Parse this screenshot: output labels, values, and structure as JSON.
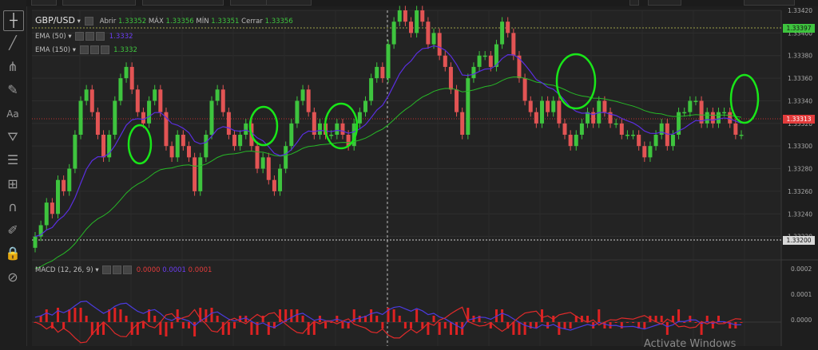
{
  "toolbar": {
    "tools": [
      {
        "name": "crosshair-tool",
        "glyph": "┼"
      },
      {
        "name": "trendline-tool",
        "glyph": "╱"
      },
      {
        "name": "fork-tool",
        "glyph": "⋔"
      },
      {
        "name": "brush-tool",
        "glyph": "✎"
      },
      {
        "name": "text-tool",
        "glyph": "Aa"
      },
      {
        "name": "pattern-tool",
        "glyph": "⛛"
      },
      {
        "name": "fib-tool",
        "glyph": "☰"
      },
      {
        "name": "measure-tool",
        "glyph": "⊞"
      },
      {
        "name": "magnet-tool",
        "glyph": "∩"
      },
      {
        "name": "ruler-tool",
        "glyph": "✐"
      },
      {
        "name": "lock-tool",
        "glyph": "🔒"
      },
      {
        "name": "hide-tool",
        "glyph": "⊘"
      }
    ]
  },
  "header": {
    "symbol": "GBP/USD",
    "open_label": "Abrir",
    "open_value": "1.33352",
    "high_label": "MÁX",
    "high_value": "1.33356",
    "low_label": "MÍN",
    "low_value": "1.33351",
    "close_label": "Cerrar",
    "close_value": "1.33356"
  },
  "indicators": [
    {
      "label": "EMA (50)",
      "value": "1.3332",
      "color": "#6a3cf0"
    },
    {
      "label": "EMA (150)",
      "value": "1.3332",
      "color": "#3ec43e"
    }
  ],
  "macd": {
    "label": "MACD (12, 26, 9)",
    "v1": "0.0000",
    "v2": "0.0001",
    "v3": "0.0001"
  },
  "price_tags": {
    "top": "1.33397",
    "current": "1.33313",
    "bottom": "1.33200"
  },
  "watermark": "Activate Windows",
  "colors": {
    "up": "#3ec43e",
    "down": "#e25454",
    "ema50": "#5a2ee0",
    "ema150": "#27b827",
    "macd_line": "#e02a2a",
    "signal_line": "#4b3be0"
  },
  "chart_data": {
    "type": "candlestick",
    "title": "GBP/USD",
    "ylabel": "",
    "ylim": [
      1.332,
      1.3342
    ],
    "yticks": [
      1.3342,
      1.3334,
      1.3336,
      1.3334,
      1.3332,
      1.333,
      1.3328,
      1.3326,
      1.3324,
      1.3322
    ],
    "ytick_labels": [
      "1.33420",
      "1.33400",
      "1.33380",
      "1.33360",
      "1.33340",
      "1.33320",
      "1.33300",
      "1.33280",
      "1.33260",
      "1.33240",
      "1.33220"
    ],
    "close_series": [
      1.3322,
      1.3323,
      1.3325,
      1.3324,
      1.3327,
      1.3326,
      1.3328,
      1.3331,
      1.3334,
      1.3335,
      1.3333,
      1.3331,
      1.3329,
      1.3331,
      1.3334,
      1.3336,
      1.3337,
      1.3335,
      1.3333,
      1.3332,
      1.3334,
      1.3335,
      1.3333,
      1.333,
      1.3329,
      1.3331,
      1.333,
      1.3329,
      1.3326,
      1.3329,
      1.3331,
      1.3334,
      1.3335,
      1.3333,
      1.3331,
      1.333,
      1.3331,
      1.3332,
      1.333,
      1.3328,
      1.3329,
      1.3327,
      1.3326,
      1.3328,
      1.333,
      1.3332,
      1.3334,
      1.3335,
      1.3333,
      1.3331,
      1.3332,
      1.3331,
      1.3331,
      1.3332,
      1.3331,
      1.333,
      1.3332,
      1.3333,
      1.3334,
      1.3336,
      1.3337,
      1.3336,
      1.3339,
      1.3341,
      1.3342,
      1.3341,
      1.334,
      1.3342,
      1.3341,
      1.3339,
      1.334,
      1.3338,
      1.3337,
      1.3335,
      1.3333,
      1.3331,
      1.3336,
      1.3337,
      1.3338,
      1.3338,
      1.3337,
      1.3339,
      1.3341,
      1.334,
      1.3338,
      1.3336,
      1.3334,
      1.3333,
      1.3332,
      1.3334,
      1.3333,
      1.3334,
      1.3332,
      1.3331,
      1.333,
      1.3331,
      1.3332,
      1.3333,
      1.3332,
      1.3334,
      1.3333,
      1.3332,
      1.3332,
      1.3331,
      1.3331,
      1.3331,
      1.333,
      1.3329,
      1.333,
      1.3331,
      1.3332,
      1.333,
      1.3331,
      1.3333,
      1.3333,
      1.3334,
      1.3334,
      1.3332,
      1.3333,
      1.3332,
      1.3333,
      1.3333,
      1.3332,
      1.3331,
      1.3331
    ],
    "ema50_last": 1.3332,
    "ema150_last": 1.3332,
    "macd_yticks": [
      "0.0002",
      "0.0001",
      "0.0000"
    ]
  }
}
